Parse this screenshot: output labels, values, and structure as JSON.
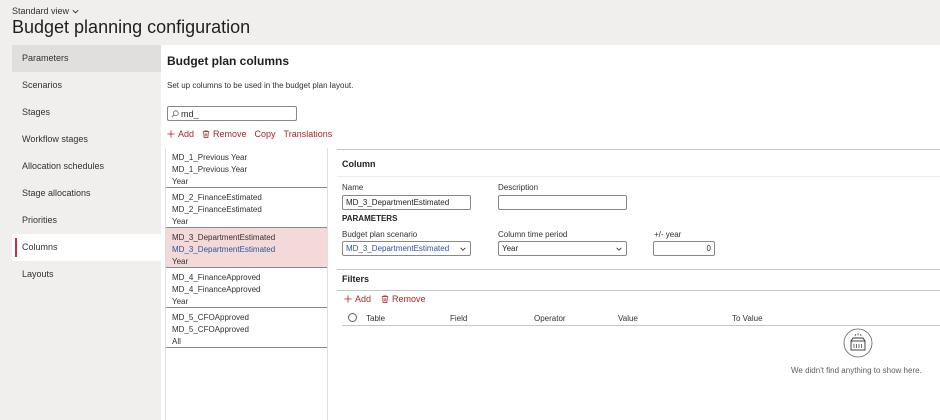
{
  "header": {
    "view_label": "Standard view",
    "title": "Budget planning configuration"
  },
  "sidebar": {
    "items": [
      {
        "label": "Parameters"
      },
      {
        "label": "Scenarios"
      },
      {
        "label": "Stages"
      },
      {
        "label": "Workflow stages"
      },
      {
        "label": "Allocation schedules"
      },
      {
        "label": "Stage allocations"
      },
      {
        "label": "Priorities"
      },
      {
        "label": "Columns"
      },
      {
        "label": "Layouts"
      }
    ]
  },
  "main": {
    "section_title": "Budget plan columns",
    "description": "Set up columns to be used in the budget plan layout.",
    "filter_value": "md_",
    "toolbar": {
      "add": "Add",
      "remove": "Remove",
      "copy": "Copy",
      "translations": "Translations"
    },
    "list": [
      {
        "line1": "MD_1_Previous Year",
        "line2": "MD_1_Previous Year",
        "line3": "Year"
      },
      {
        "line1": "MD_2_FinanceEstimated",
        "line2": "MD_2_FinanceEstimated",
        "line3": "Year"
      },
      {
        "line1": "MD_3_DepartmentEstimated",
        "line2": "MD_3_DepartmentEstimated",
        "line3": "Year"
      },
      {
        "line1": "MD_4_FinanceApproved",
        "line2": "MD_4_FinanceApproved",
        "line3": "Year"
      },
      {
        "line1": "MD_5_CFOApproved",
        "line2": "MD_5_CFOApproved",
        "line3": "All"
      }
    ],
    "selected_index": 2
  },
  "column": {
    "title": "Column",
    "name_label": "Name",
    "name_value": "MD_3_DepartmentEstimated",
    "description_label": "Description",
    "description_value": "",
    "parameters_heading": "PARAMETERS",
    "scenario_label": "Budget plan scenario",
    "scenario_value": "MD_3_DepartmentEstimated",
    "period_label": "Column time period",
    "period_value": "Year",
    "year_label": "+/- year",
    "year_value": "0"
  },
  "filters": {
    "title": "Filters",
    "add": "Add",
    "remove": "Remove",
    "columns": [
      "Table",
      "Field",
      "Operator",
      "Value",
      "To Value"
    ],
    "empty_message": "We didn't find anything to show here."
  },
  "colors": {
    "accent": "#a4262c",
    "selected_row": "#f4d9d9",
    "link_blue": "#2b579a"
  }
}
